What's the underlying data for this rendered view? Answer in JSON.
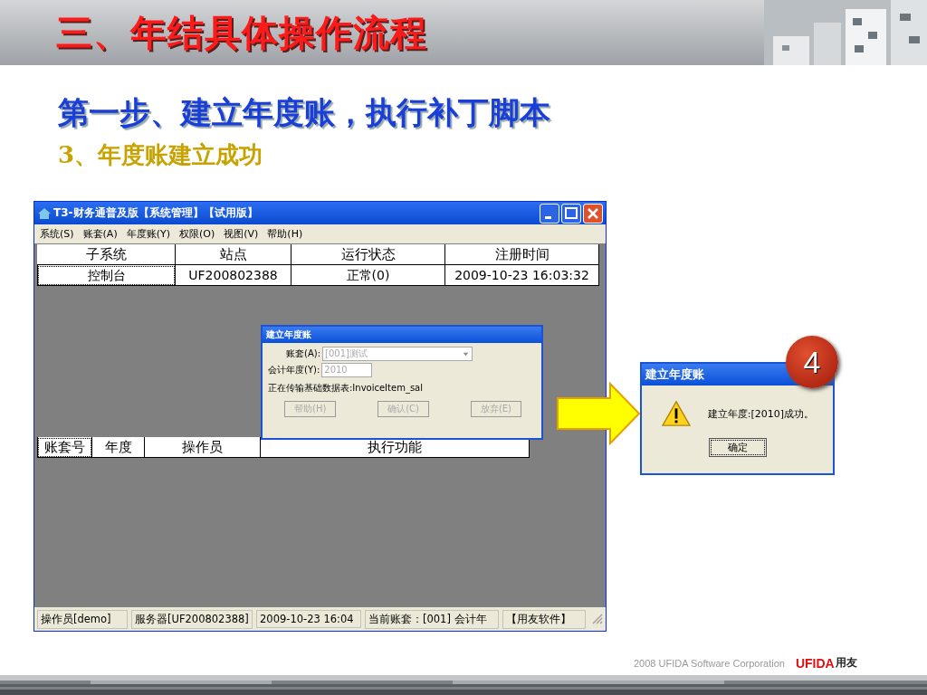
{
  "slide": {
    "title": "三、年结具体操作流程",
    "step": "第一步、建立年度账，执行补丁脚本",
    "substep": "3、年度账建立成功",
    "footer": {
      "copyright": "2008 UFIDA Software Corporation",
      "brand": "UFIDA",
      "brand_cn": "用友"
    }
  },
  "main_window": {
    "title": "T3-财务通普及版【系统管理】【试用版】",
    "menu": [
      "系统(S)",
      "账套(A)",
      "年度账(Y)",
      "权限(O)",
      "视图(V)",
      "帮助(H)"
    ],
    "sessions": {
      "columns": [
        "子系统",
        "站点",
        "运行状态",
        "注册时间"
      ],
      "rows": [
        [
          "控制台",
          "UF200802388",
          "正常(0)",
          "2009-10-23 16:03:32"
        ]
      ]
    },
    "tasks": {
      "columns": [
        "账套号",
        "年度",
        "操作员",
        "执行功能"
      ]
    },
    "status_bar": [
      "操作员[demo]",
      "服务器[UF200802388]",
      "2009-10-23 16:04",
      "当前账套：[001] 会计年",
      "【用友软件】"
    ]
  },
  "create_dialog": {
    "title": "建立年度账",
    "fields": [
      {
        "label": "账套(A):",
        "value": "[001]测试",
        "kind": "dropdown",
        "disabled": true
      },
      {
        "label": "会计年度(Y):",
        "value": "2010",
        "kind": "text",
        "disabled": true
      }
    ],
    "progress": "正在传输基础数据表:InvoiceItem_sal",
    "buttons": [
      {
        "label": "帮助(H)",
        "disabled": true
      },
      {
        "label": "确认(C)",
        "disabled": true
      },
      {
        "label": "放弃(E)",
        "disabled": true
      }
    ]
  },
  "success_dialog": {
    "title": "建立年度账",
    "message": "建立年度:[2010]成功。",
    "button": "确定"
  },
  "callout": {
    "number": "4"
  }
}
